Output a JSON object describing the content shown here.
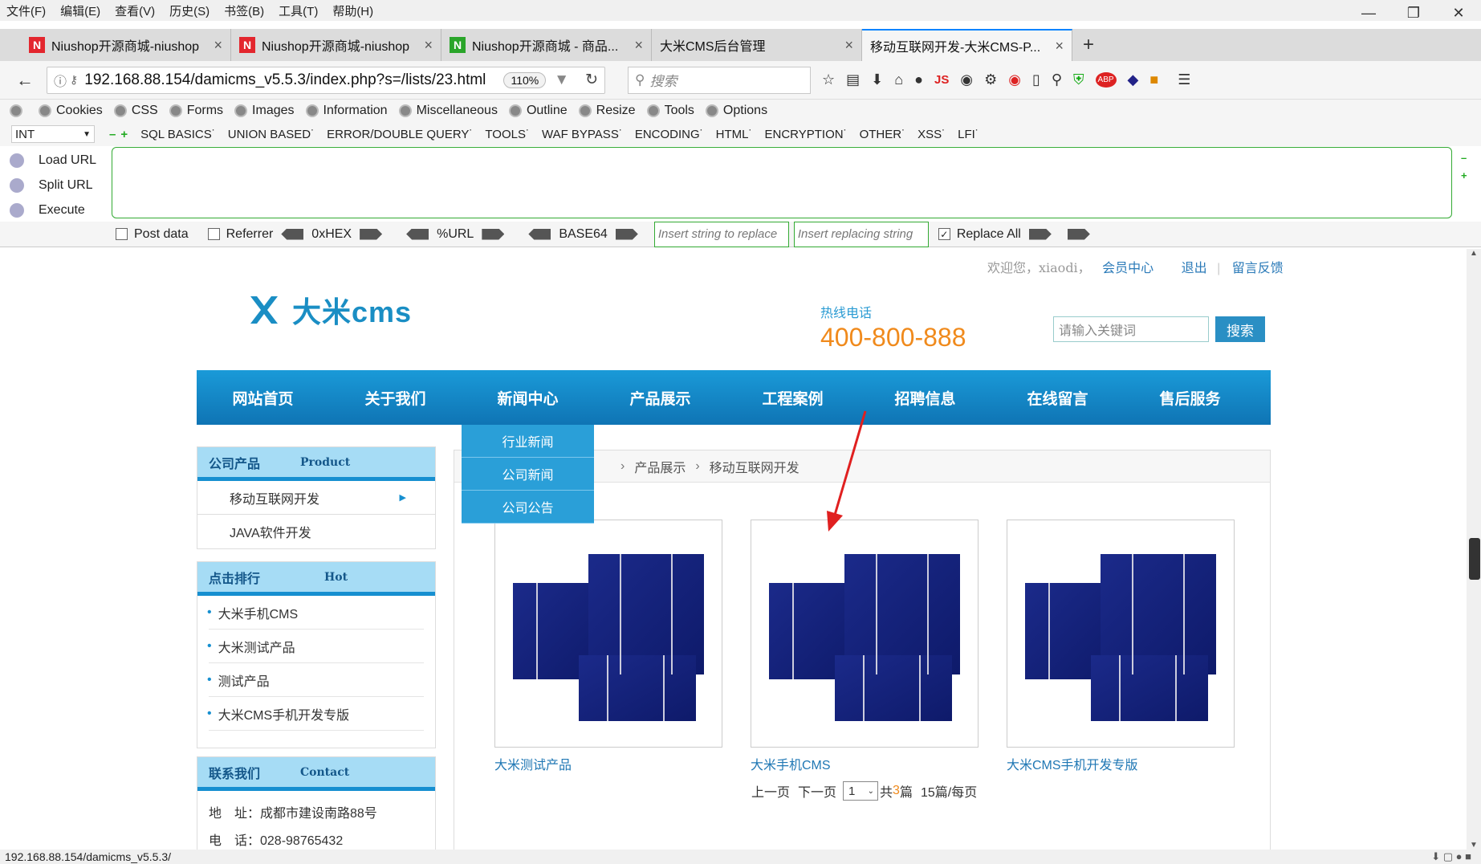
{
  "browser": {
    "menu": [
      "文件(F)",
      "编辑(E)",
      "查看(V)",
      "历史(S)",
      "书签(B)",
      "工具(T)",
      "帮助(H)"
    ],
    "tabs": [
      {
        "title": "Niushop开源商城-niushop",
        "icon": "N",
        "icon_color": "#e3262e"
      },
      {
        "title": "Niushop开源商城-niushop",
        "icon": "N",
        "icon_color": "#e3262e"
      },
      {
        "title": "Niushop开源商城 - 商品...",
        "icon": "N",
        "icon_color": "#2aa52a"
      },
      {
        "title": "大米CMS后台管理",
        "icon": "",
        "icon_color": ""
      },
      {
        "title": "移动互联网开发-大米CMS-P...",
        "icon": "",
        "icon_color": ""
      }
    ],
    "url": "192.168.88.154/damicms_v5.5.3/index.php?s=/lists/23.html",
    "zoom": "110%",
    "search_placeholder": "搜索",
    "status_url": "192.168.88.154/damicms_v5.5.3/"
  },
  "hackbar": {
    "toolbar": [
      "Cookies",
      "CSS",
      "Forms",
      "Images",
      "Information",
      "Miscellaneous",
      "Outline",
      "Resize",
      "Tools",
      "Options"
    ],
    "type_select": "INT",
    "menus": [
      "SQL BASICS",
      "UNION BASED",
      "ERROR/DOUBLE QUERY",
      "TOOLS",
      "WAF BYPASS",
      "ENCODING",
      "HTML",
      "ENCRYPTION",
      "OTHER",
      "XSS",
      "LFI"
    ],
    "actions": [
      "Load URL",
      "Split URL",
      "Execute"
    ],
    "post_data": "Post data",
    "referrer": "Referrer",
    "hex": "0xHEX",
    "url_enc": "%URL",
    "base64": "BASE64",
    "replace_placeholder": "Insert string to replace",
    "replacing_placeholder": "Insert replacing string",
    "replace_all": "Replace All"
  },
  "site": {
    "welcome": "欢迎您，xiaodi，",
    "member_center": "会员中心",
    "logout": "退出",
    "feedback": "留言反馈",
    "logo_text": "大米cms",
    "hotline_label": "热线电话",
    "hotline": "400-800-888",
    "search_placeholder": "请输入关键词",
    "search_button": "搜索",
    "nav": [
      "网站首页",
      "关于我们",
      "新闻中心",
      "产品展示",
      "工程案例",
      "招聘信息",
      "在线留言",
      "售后服务"
    ],
    "dropdown": [
      "行业新闻",
      "公司新闻",
      "公司公告"
    ],
    "products_box": {
      "cn": "公司产品",
      "en": "Product",
      "items": [
        "移动互联网开发",
        "JAVA软件开发"
      ]
    },
    "rank_box": {
      "cn": "点击排行",
      "en": "Hot",
      "items": [
        "大米手机CMS",
        "大米测试产品",
        "测试产品",
        "大米CMS手机开发专版"
      ]
    },
    "contact_box": {
      "cn": "联系我们",
      "en": "Contact",
      "address": "地　址：成都市建设南路88号",
      "phone": "电　话：028-98765432"
    },
    "breadcrumb": [
      "产品展示",
      "移动互联网开发"
    ],
    "products": [
      "大米测试产品",
      "大米手机CMS",
      "大米CMS手机开发专版"
    ],
    "pager": {
      "prev": "上一页",
      "next": "下一页",
      "page": "1",
      "total_prefix": "共",
      "total": "3",
      "total_suffix": "篇",
      "per_page": "15篇/每页"
    }
  }
}
